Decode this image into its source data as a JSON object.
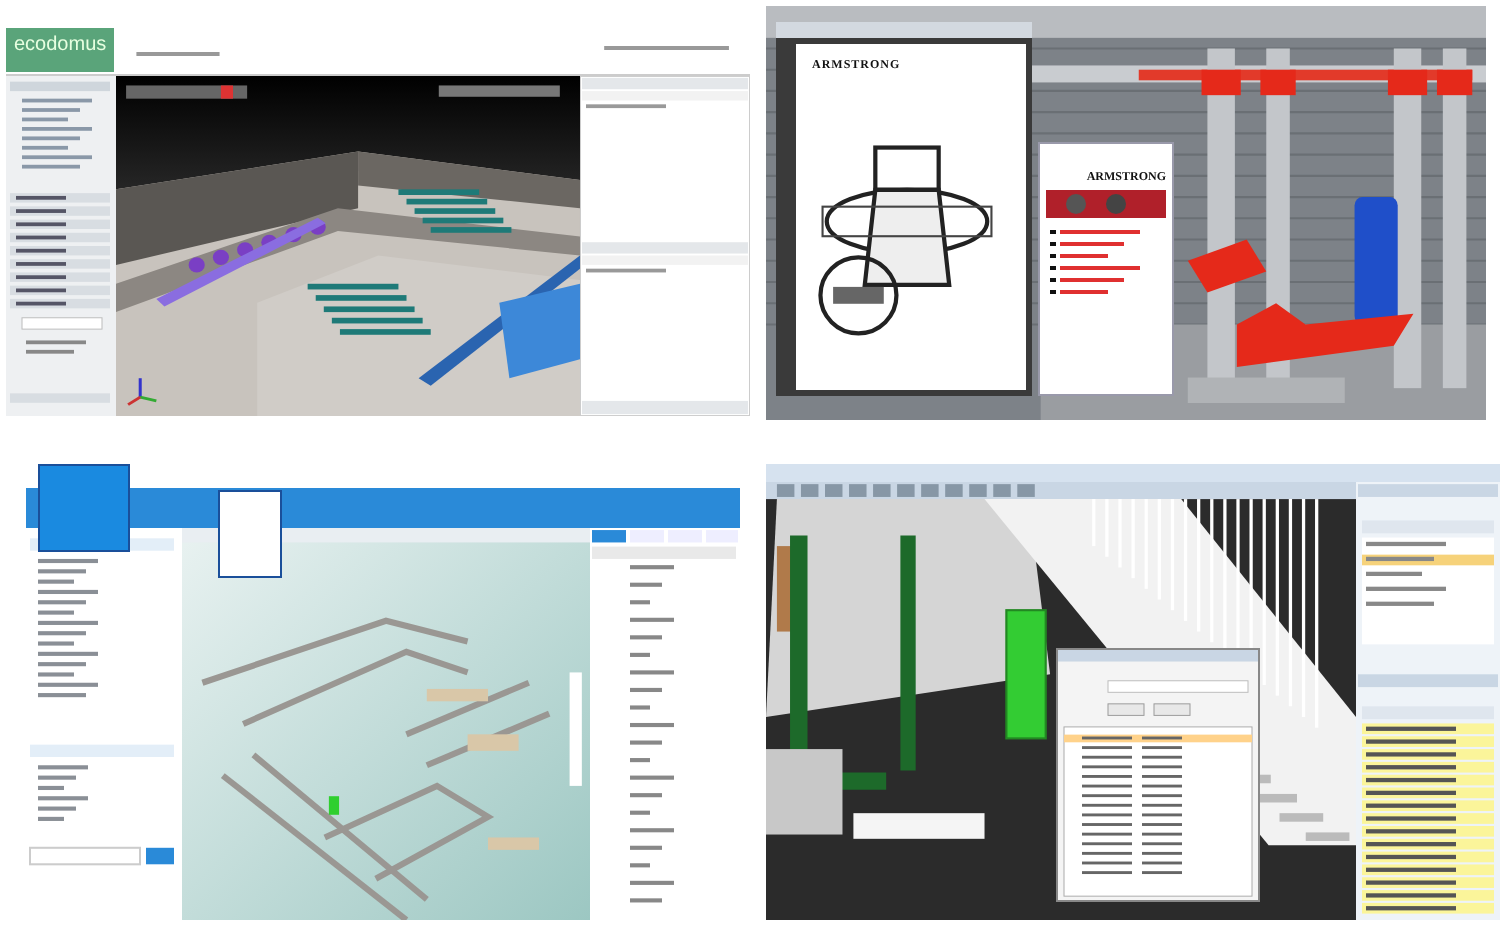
{
  "panels": [
    {
      "kind": "bim-viewer",
      "logo": "ecodomus"
    },
    {
      "kind": "document-viewer",
      "document": {
        "brand": "ARMSTRONG"
      },
      "popup": {
        "brand": "ARMSTRONG"
      }
    },
    {
      "kind": "web-viewer"
    },
    {
      "kind": "search-dialog"
    }
  ]
}
